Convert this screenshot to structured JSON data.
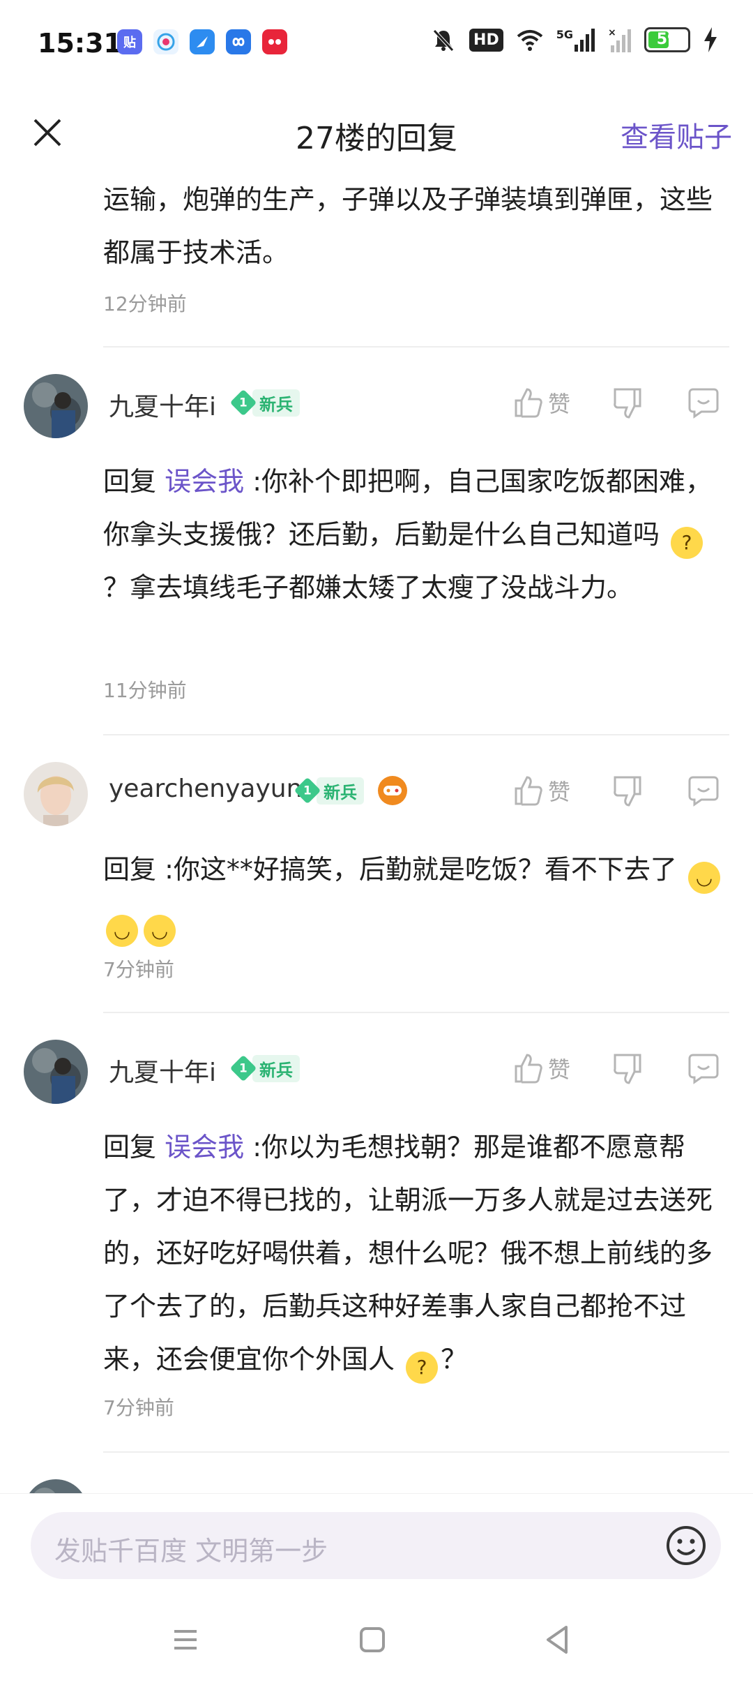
{
  "status_bar": {
    "time": "15:31",
    "app_icons": [
      "tieba-app-icon",
      "mobile-app-icon",
      "feather-app-icon",
      "infinity-app-icon",
      "tmall-app-icon"
    ],
    "app_icon_labels": [
      "贴",
      "",
      "",
      "",
      ""
    ],
    "signal_label": "5G",
    "hd_label": "HD",
    "battery_level": "59",
    "battery_percent": 59
  },
  "header": {
    "title": "27楼的回复",
    "view_post": "查看贴子"
  },
  "top_block": {
    "text": "运输，炮弹的生产，子弹以及子弹装填到弹匣，这些都属于技术活。",
    "time": "12分钟前"
  },
  "like_label": "赞",
  "comments": [
    {
      "username": "九夏十年i",
      "badge_level": "1",
      "badge_label": "新兵",
      "reply_prefix": "回复",
      "mention": "误会我",
      "text_before_emoji": " :你补个即把啊，自己国家吃饭都困难，你拿头支援俄？还后勤，后勤是什么自己知道吗",
      "text_after_emoji": "？拿去填线毛子都嫌太矮了太瘦了没战斗力。",
      "time": "11分钟前"
    },
    {
      "username": "yearchenyayun",
      "badge_level": "1",
      "badge_label": "新兵",
      "reply_prefix": "回复",
      "mention": "",
      "text_before_emoji": "  :你这**好搞笑，后勤就是吃饭？看不下去了",
      "text_after_emoji": "",
      "time": "7分钟前"
    },
    {
      "username": "九夏十年i",
      "badge_level": "1",
      "badge_label": "新兵",
      "reply_prefix": "回复",
      "mention": "误会我",
      "text_before_emoji": " :你以为毛想找朝？那是谁都不愿意帮了，才迫不得已找的，让朝派一万多人就是过去送死的，还好吃好喝供着，想什么呢？俄不想上前线的多了个去了的，后勤兵这种好差事人家自己都抢不过来，还会便宜你个外国人",
      "text_after_emoji": "？",
      "time": "7分钟前"
    }
  ],
  "input": {
    "placeholder": "发贴千百度 文明第一步"
  },
  "colors": {
    "accent": "#6b54c9",
    "badge_green": "#3cc88a",
    "meta_gray": "#9a9a9a"
  }
}
